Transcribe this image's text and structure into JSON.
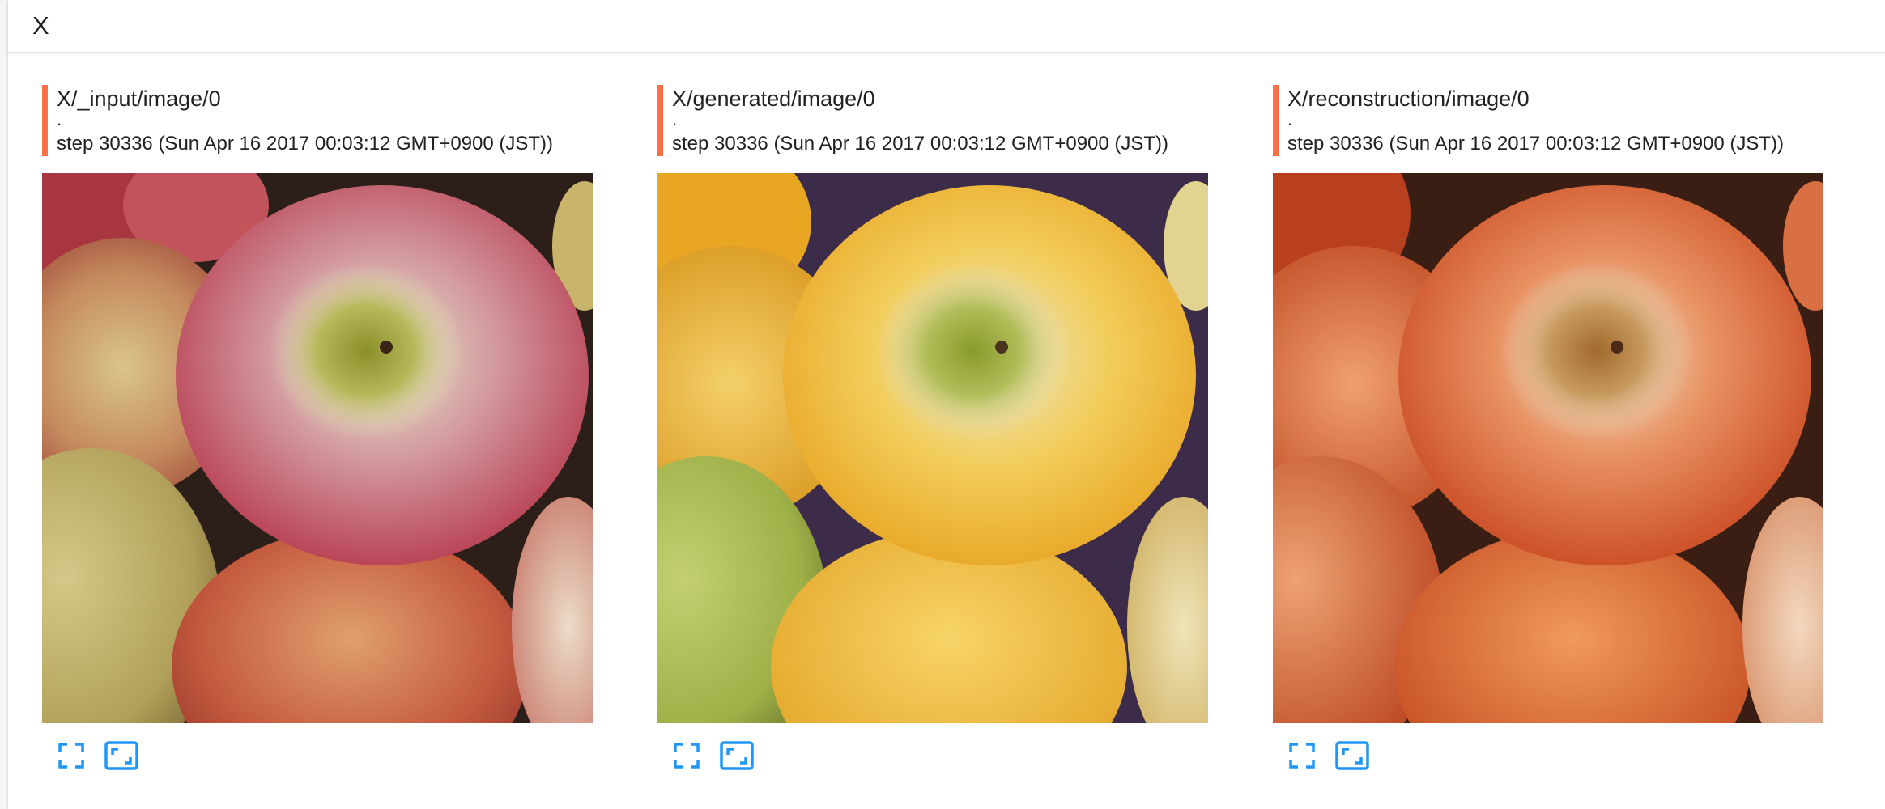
{
  "card": {
    "title": "X"
  },
  "accent_color": "#ff7043",
  "tool_color": "#2196f3",
  "panes": [
    {
      "tag": "X/_input/image/0",
      "dot": ".",
      "step": "step 30336 (Sun Apr 16 2017 00:03:12 GMT+0900 (JST))",
      "tools": [
        "fullscreen-icon",
        "actual-size-icon"
      ]
    },
    {
      "tag": "X/generated/image/0",
      "dot": ".",
      "step": "step 30336 (Sun Apr 16 2017 00:03:12 GMT+0900 (JST))",
      "tools": [
        "fullscreen-icon",
        "actual-size-icon"
      ]
    },
    {
      "tag": "X/reconstruction/image/0",
      "dot": ".",
      "step": "step 30336 (Sun Apr 16 2017 00:03:12 GMT+0900 (JST))",
      "tools": [
        "fullscreen-icon",
        "actual-size-icon"
      ]
    }
  ]
}
